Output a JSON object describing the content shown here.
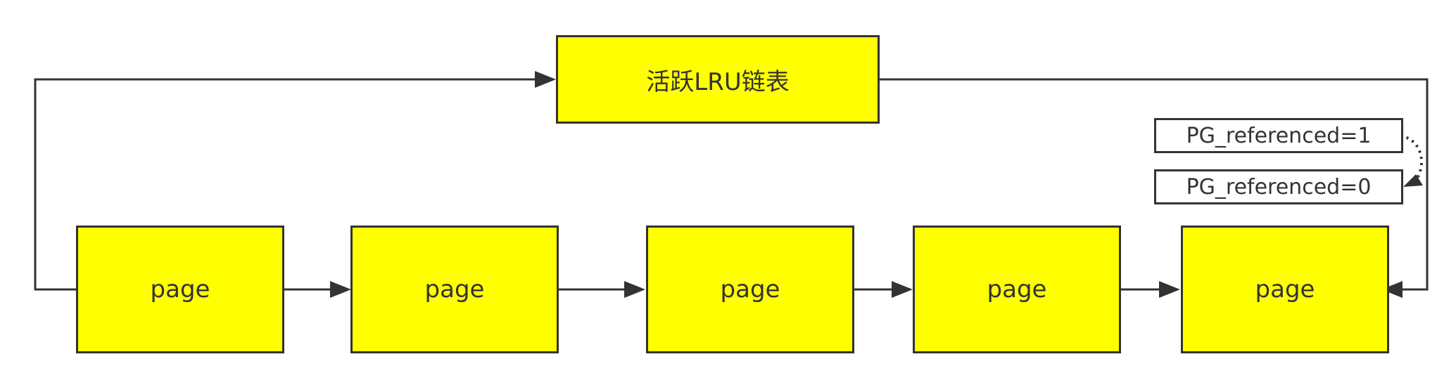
{
  "diagram": {
    "title_box": {
      "label": "活跃LRU链表"
    },
    "pages": [
      {
        "label": "page"
      },
      {
        "label": "page"
      },
      {
        "label": "page"
      },
      {
        "label": "page"
      },
      {
        "label": "page"
      }
    ],
    "flags": {
      "before": "PG_referenced=1",
      "after": "PG_referenced=0"
    },
    "colors": {
      "box_fill": "#ffff00",
      "stroke": "#333333",
      "background": "#ffffff"
    }
  }
}
